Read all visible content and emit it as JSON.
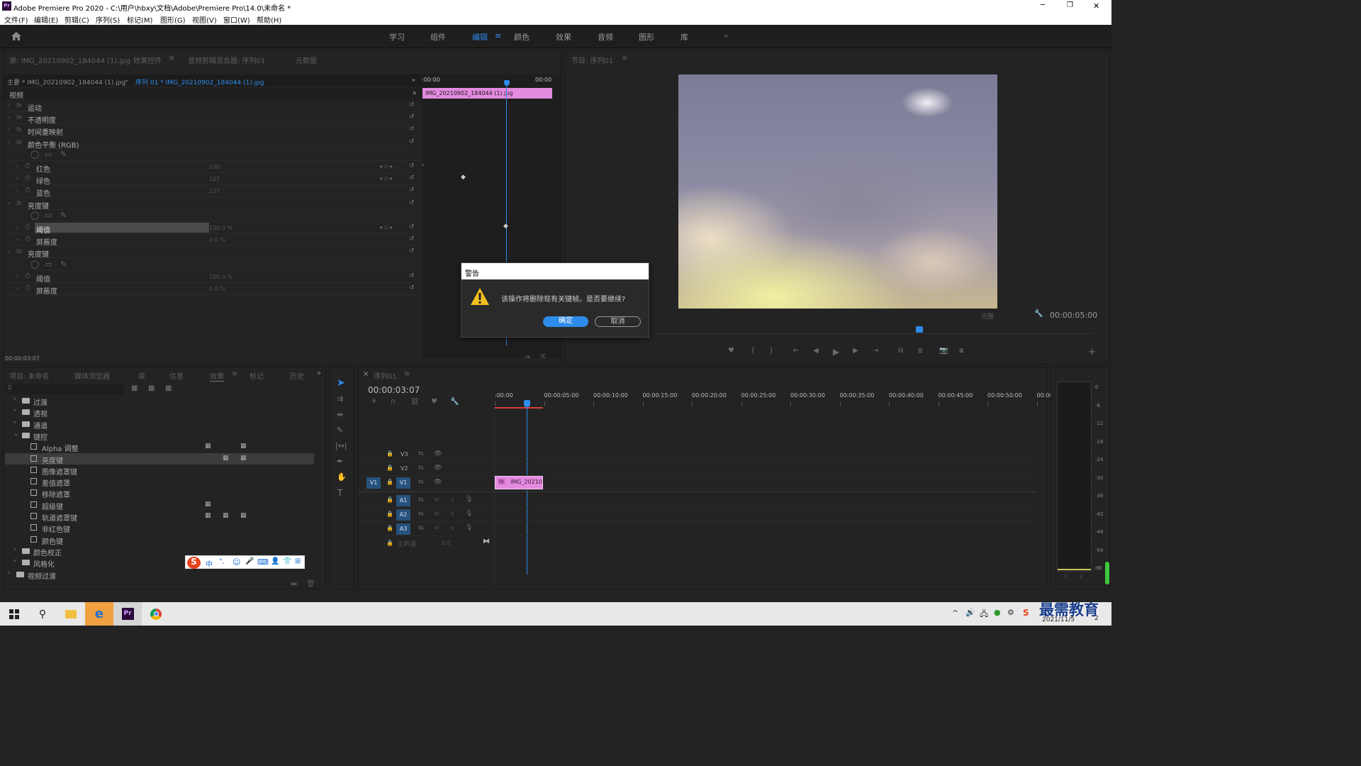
{
  "window": {
    "title": "Adobe Premiere Pro 2020 - C:\\用户\\hbxy\\文档\\Adobe\\Premiere Pro\\14.0\\未命名 *",
    "controls": [
      "─",
      "❐",
      "✕"
    ]
  },
  "menu": [
    "文件(F)",
    "编辑(E)",
    "剪辑(C)",
    "序列(S)",
    "标记(M)",
    "图形(G)",
    "视图(V)",
    "窗口(W)",
    "帮助(H)"
  ],
  "workspaces": {
    "tabs": [
      "学习",
      "组件",
      "编辑",
      "颜色",
      "效果",
      "音频",
      "图形",
      "库"
    ],
    "active": "编辑",
    "menu_glyph": "≡",
    "more": "»"
  },
  "source_panel": {
    "tabs": [
      "源: IMG_20210902_184044 (1).jpg",
      "效果控件",
      "音频剪辑混合器: 序列01",
      "元数据"
    ],
    "tab_menu": "≡",
    "master_label": "主要 * IMG_20210902_184044 (1).jpg",
    "sequence_label": "序列 01 * IMG_20210902_184044 (1).jpg",
    "section_video": "视频",
    "ruler_start": ":00:00",
    "ruler_end": "00:00",
    "clip_name": "IMG_20210902_184044 (1).jpg",
    "timecode": "00:00:03:07",
    "effects": [
      {
        "label": "运动",
        "type": "fx"
      },
      {
        "label": "不透明度",
        "type": "fx"
      },
      {
        "label": "时间重映射",
        "type": "fx"
      },
      {
        "label": "颜色平衡 (RGB)",
        "type": "fx"
      },
      {
        "label": "",
        "type": "mask"
      },
      {
        "label": "红色",
        "type": "param",
        "value": "100"
      },
      {
        "label": "绿色",
        "type": "param",
        "value": "107"
      },
      {
        "label": "蓝色",
        "type": "param",
        "value": "137"
      },
      {
        "label": "亮度键",
        "type": "fx"
      },
      {
        "label": "",
        "type": "mask"
      },
      {
        "label": "阈值",
        "type": "param",
        "value": "100.0 %",
        "selected": true
      },
      {
        "label": "屏蔽度",
        "type": "param",
        "value": "0.0 %"
      },
      {
        "label": "亮度键",
        "type": "fx"
      },
      {
        "label": "",
        "type": "mask"
      },
      {
        "label": "阈值",
        "type": "param",
        "value": "100.0 %"
      },
      {
        "label": "屏蔽度",
        "type": "param",
        "value": "0.0 %"
      }
    ]
  },
  "program_monitor": {
    "title": "节目: 序列01",
    "tab_menu": "≡",
    "quality": "完整",
    "timecode": "00:00:05:00"
  },
  "dialog": {
    "title": "警告",
    "message": "该操作将删除现有关键帧。是否要继续?",
    "ok": "确定",
    "cancel": "取消",
    "icon": "warning-icon"
  },
  "project_panel": {
    "tabs": [
      "项目: 未命名",
      "媒体浏览器",
      "库",
      "信息",
      "效果",
      "标记",
      "历史"
    ],
    "tab_menu": "≡",
    "more": "»",
    "tree": [
      {
        "label": "过渡",
        "kind": "folder",
        "level": 1,
        "expanded": false
      },
      {
        "label": "透视",
        "kind": "folder",
        "level": 1,
        "expanded": false
      },
      {
        "label": "通道",
        "kind": "folder",
        "level": 1,
        "expanded": false
      },
      {
        "label": "键控",
        "kind": "folder",
        "level": 1,
        "expanded": true
      },
      {
        "label": "Alpha 调整",
        "kind": "preset",
        "level": 2,
        "badges": [
          1,
          0,
          1
        ]
      },
      {
        "label": "亮度键",
        "kind": "preset",
        "level": 2,
        "badges": [
          0,
          1,
          1
        ],
        "selected": true
      },
      {
        "label": "图像遮罩键",
        "kind": "preset",
        "level": 2,
        "badges": [
          0,
          0,
          0
        ]
      },
      {
        "label": "差值遮罩",
        "kind": "preset",
        "level": 2,
        "badges": [
          0,
          0,
          0
        ]
      },
      {
        "label": "移除遮罩",
        "kind": "preset",
        "level": 2,
        "badges": [
          0,
          0,
          0
        ]
      },
      {
        "label": "超级键",
        "kind": "preset",
        "level": 2,
        "badges": [
          1,
          0,
          0
        ]
      },
      {
        "label": "轨道遮罩键",
        "kind": "preset",
        "level": 2,
        "badges": [
          1,
          1,
          1
        ]
      },
      {
        "label": "非红色键",
        "kind": "preset",
        "level": 2,
        "badges": [
          0,
          0,
          0
        ]
      },
      {
        "label": "颜色键",
        "kind": "preset",
        "level": 2,
        "badges": [
          0,
          0,
          0
        ]
      },
      {
        "label": "颜色校正",
        "kind": "folder",
        "level": 1,
        "expanded": false
      },
      {
        "label": "风格化",
        "kind": "folder",
        "level": 1,
        "expanded": false
      },
      {
        "label": "视频过渡",
        "kind": "folder",
        "level": 0,
        "expanded": false
      }
    ]
  },
  "ime_toolbar": [
    "S",
    "中",
    "°,",
    "☺",
    "🎤",
    "⌨",
    "👤",
    "👕",
    "⊞"
  ],
  "timeline": {
    "title": "序列01",
    "close": "×",
    "tab_menu": "≡",
    "timecode": "00:00:03:07",
    "ruler": [
      ":00:00",
      "00:00:05:00",
      "00:00:10:00",
      "00:00:15:00",
      "00:00:20:00",
      "00:00:25:00",
      "00:00:30:00",
      "00:00:35:00",
      "00:00:40:00",
      "00:00:45:00",
      "00:00:50:00",
      "00:00"
    ],
    "video_tracks": [
      "V3",
      "V2",
      "V1"
    ],
    "audio_tracks": [
      "A1",
      "A2",
      "A3"
    ],
    "source_patch": "V1",
    "master": "主声道",
    "master_value": "0.0",
    "clip_label": "IMG_20210",
    "mute": "M",
    "solo": "S"
  },
  "audio_meter": {
    "scale": [
      "0",
      "-6",
      "-12",
      "-18",
      "-24",
      "-30",
      "-36",
      "-42",
      "-48",
      "-54",
      "dB"
    ],
    "solo_buttons": [
      "S",
      "S"
    ]
  },
  "taskbar": {
    "clock_date": "2021/11/5",
    "watermark": "最需教育",
    "notification_count": "2",
    "ime_icon": "S"
  }
}
